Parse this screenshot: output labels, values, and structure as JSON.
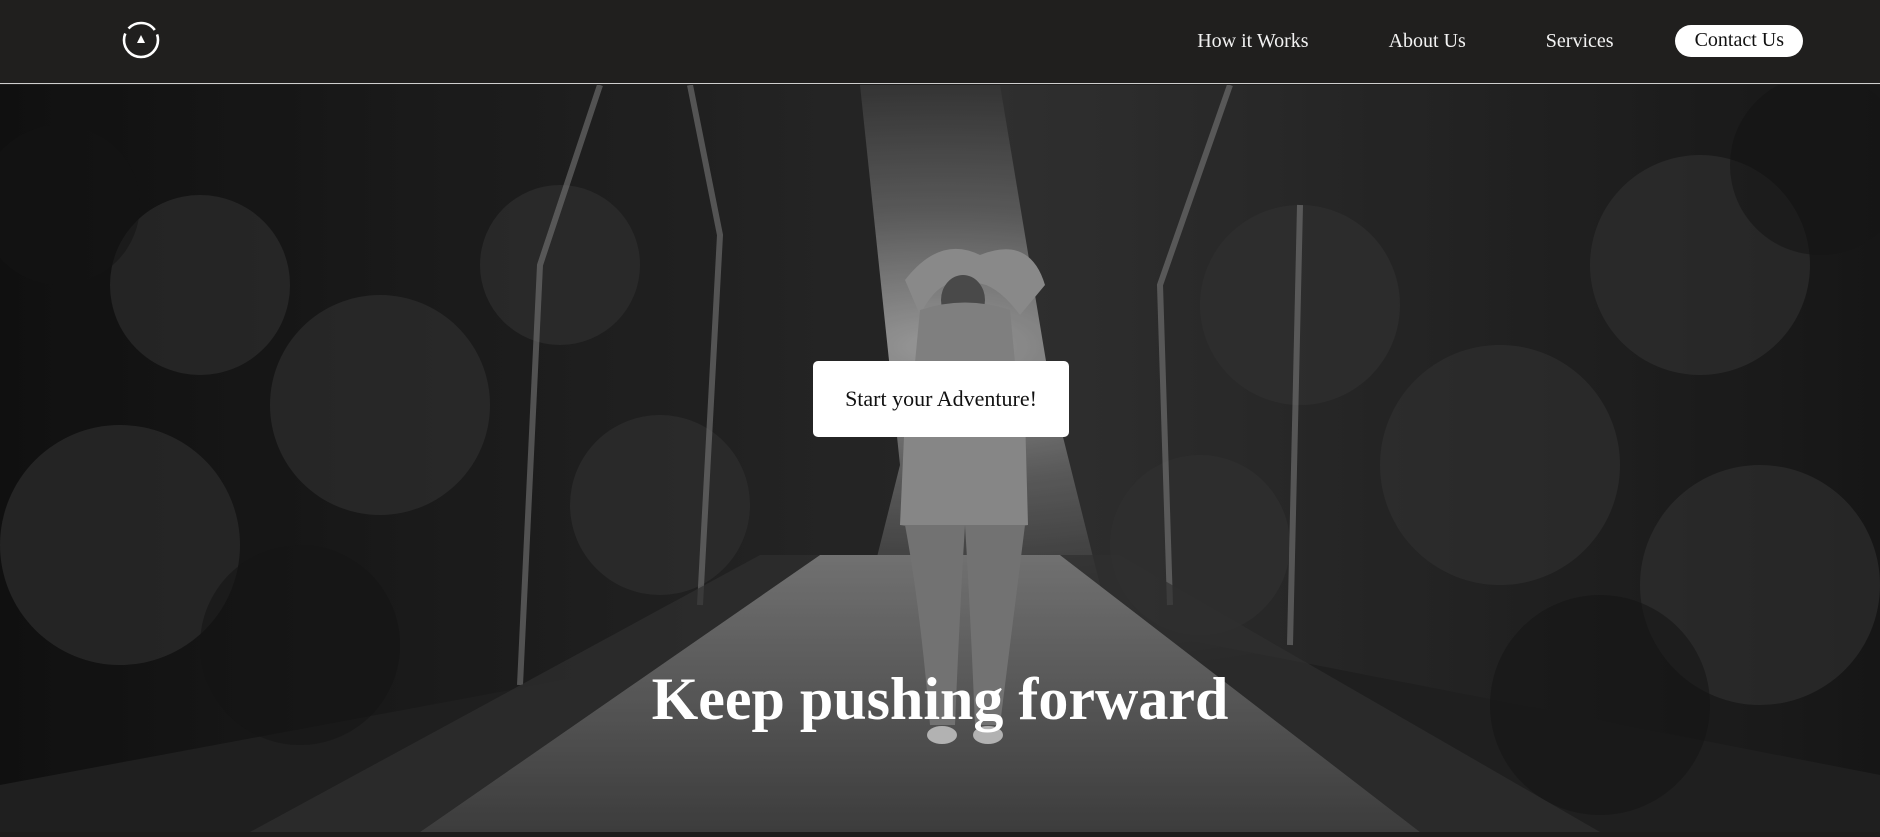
{
  "nav": {
    "logo_icon": "compass-icon",
    "links": [
      {
        "label": "How it Works"
      },
      {
        "label": "About Us"
      },
      {
        "label": "Services"
      }
    ],
    "contact_label": "Contact Us"
  },
  "hero": {
    "background": "black-and-white photo of a woman stretching on a tree-lined road",
    "cta_label": "Start your Adventure!",
    "title": "Keep pushing forward"
  },
  "colors": {
    "navbar_bg": "#201f1e",
    "nav_text": "#f2f2f2",
    "button_bg": "#ffffff",
    "button_text": "#111111"
  }
}
